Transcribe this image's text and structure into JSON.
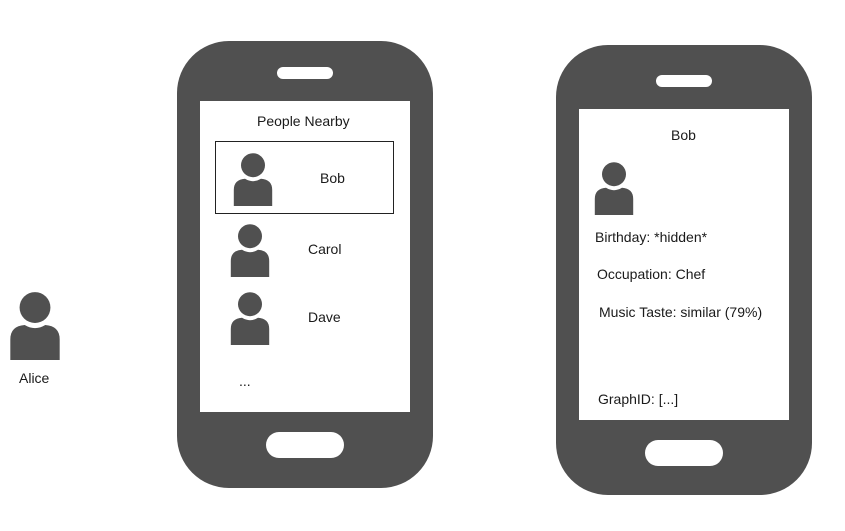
{
  "colors": {
    "phone_body": "#505050",
    "screen": "#ffffff",
    "icon": "#505050",
    "text": "#1a1a1a"
  },
  "alice": {
    "name": "Alice",
    "icon": "person-icon"
  },
  "nearby_screen": {
    "title": "People Nearby",
    "people": [
      {
        "name": "Bob",
        "selected": true,
        "icon": "person-icon"
      },
      {
        "name": "Carol",
        "selected": false,
        "icon": "person-icon"
      },
      {
        "name": "Dave",
        "selected": false,
        "icon": "person-icon"
      }
    ],
    "more": "..."
  },
  "profile_screen": {
    "name": "Bob",
    "icon": "person-icon",
    "birthday": "Birthday:  *hidden*",
    "occupation": "Occupation: Chef",
    "music": "Music Taste: similar (79%)",
    "graph_id": "GraphID: [...]"
  }
}
